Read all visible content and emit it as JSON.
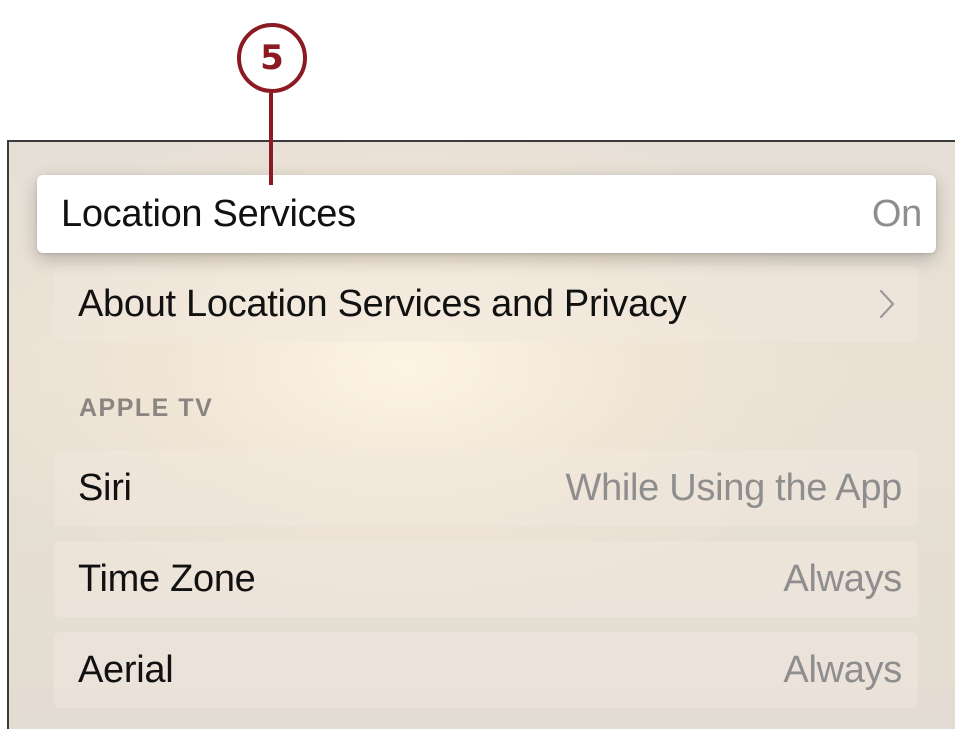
{
  "callout": {
    "number": "5"
  },
  "settings": {
    "location_services": {
      "label": "Location Services",
      "value": "On"
    },
    "about": {
      "label": "About Location Services and Privacy",
      "icon": "chevron-right-icon"
    },
    "section_header": "APPLE TV",
    "items": [
      {
        "label": "Siri",
        "value": "While Using the App"
      },
      {
        "label": "Time Zone",
        "value": "Always"
      },
      {
        "label": "Aerial",
        "value": "Always"
      }
    ]
  },
  "colors": {
    "callout": "#8b1a22",
    "focused_row": "#ffffff",
    "value_text": "#8e8e8e"
  }
}
